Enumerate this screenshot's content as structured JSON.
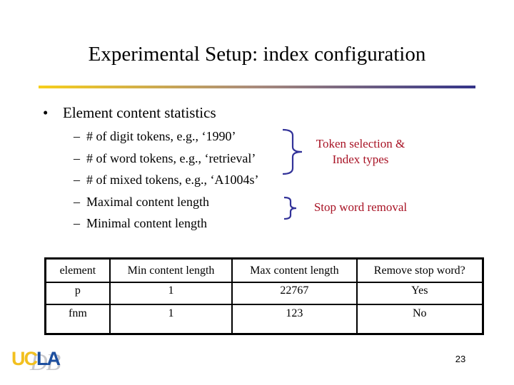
{
  "slide": {
    "title": "Experimental Setup: index configuration",
    "rule_gradient": [
      "#f7cf1b",
      "#333388"
    ],
    "page_number": "23"
  },
  "content": {
    "bullet_symbol": "•",
    "main_bullet": "Element content statistics",
    "sub_dash": "–",
    "sub_items": [
      "# of digit tokens, e.g., ‘1990’",
      "# of word tokens, e.g., ‘retrieval’",
      "# of mixed tokens, e.g., ‘A1004s’",
      "Maximal content length",
      "Minimal content length"
    ]
  },
  "annotations": {
    "color": "#a81325",
    "brace_color": "#333399",
    "token_note_line1": "Token selection &",
    "token_note_line2": "Index types",
    "stopword_note": "Stop word removal"
  },
  "table": {
    "headers": [
      "element",
      "Min content length",
      "Max content length",
      "Remove stop word?"
    ],
    "rows": [
      [
        "p",
        "1",
        "22767",
        "Yes"
      ],
      [
        "fnm",
        "1",
        "123",
        "No"
      ]
    ]
  },
  "logo": {
    "part1": "UC",
    "part2": "LA",
    "overlay": "DB"
  }
}
